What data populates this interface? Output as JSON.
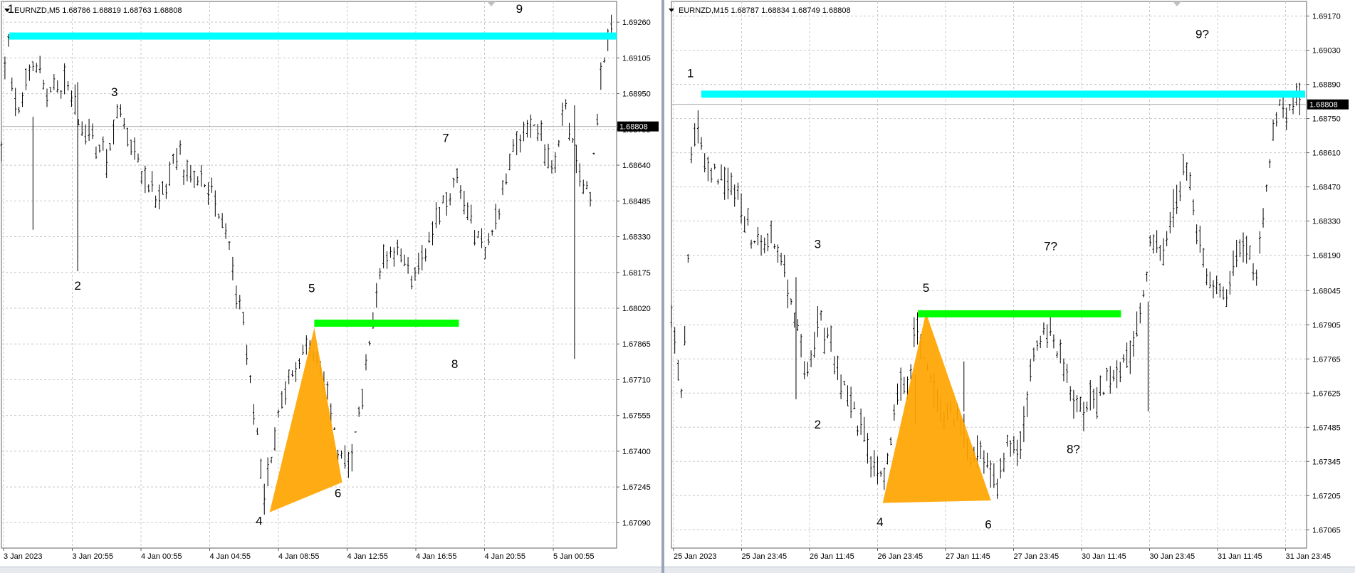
{
  "chart_data": [
    {
      "type": "candlestick",
      "symbol_header": "EURNZD,M5  1.68786 1.68819 1.68763 1.68808",
      "title": "EURNZD,M5",
      "ohlc": {
        "open": 1.68786,
        "high": 1.68819,
        "low": 1.68763,
        "close": 1.68808
      },
      "current_price": "1.68808",
      "ylim": [
        1.6698,
        1.6935
      ],
      "y_ticks": [
        "1.69260",
        "1.69105",
        "1.68950",
        "1.68795",
        "1.68640",
        "1.68485",
        "1.68330",
        "1.68175",
        "1.68020",
        "1.67865",
        "1.67710",
        "1.67555",
        "1.67400",
        "1.67245",
        "1.67090"
      ],
      "x_ticks": [
        "3 Jan 2023",
        "3 Jan 20:55",
        "4 Jan 00:55",
        "4 Jan 04:55",
        "4 Jan 08:55",
        "4 Jan 12:55",
        "4 Jan 16:55",
        "4 Jan 20:55",
        "5 Jan 00:55"
      ],
      "grid": true,
      "path_points": [
        [
          0,
          1.6875
        ],
        [
          0.01,
          1.6922
        ],
        [
          0.03,
          1.6885
        ],
        [
          0.06,
          1.691
        ],
        [
          0.09,
          1.6895
        ],
        [
          0.12,
          1.69
        ],
        [
          0.15,
          1.6885
        ],
        [
          0.18,
          1.687
        ],
        [
          0.2,
          1.6867
        ],
        [
          0.225,
          1.6888
        ],
        [
          0.25,
          1.687
        ],
        [
          0.28,
          1.6855
        ],
        [
          0.31,
          1.685
        ],
        [
          0.33,
          1.687
        ],
        [
          0.36,
          1.686
        ],
        [
          0.39,
          1.6855
        ],
        [
          0.42,
          1.684
        ],
        [
          0.44,
          1.682
        ],
        [
          0.47,
          1.678
        ],
        [
          0.5,
          1.672
        ],
        [
          0.53,
          1.676
        ],
        [
          0.58,
          1.679
        ],
        [
          0.61,
          1.6775
        ],
        [
          0.64,
          1.674
        ],
        [
          0.665,
          1.6735
        ],
        [
          0.69,
          1.677
        ],
        [
          0.72,
          1.682
        ],
        [
          0.75,
          1.683
        ],
        [
          0.78,
          1.6815
        ],
        [
          0.81,
          1.683
        ],
        [
          0.84,
          1.685
        ],
        [
          0.87,
          1.6855
        ],
        [
          0.89,
          1.684
        ],
        [
          0.92,
          1.683
        ],
        [
          0.95,
          1.6845
        ],
        [
          0.97,
          1.687
        ],
        [
          1.0,
          1.6885
        ],
        [
          1.03,
          1.6875
        ],
        [
          1.05,
          1.686
        ],
        [
          1.07,
          1.689
        ],
        [
          1.09,
          1.687
        ],
        [
          1.12,
          1.685
        ],
        [
          1.14,
          1.69
        ],
        [
          1.16,
          1.6925
        ]
      ],
      "spikes": [
        [
          0.06,
          1.6836
        ],
        [
          0.145,
          1.6818
        ],
        [
          1.09,
          1.678
        ]
      ],
      "zones": [
        {
          "color": "#00ffff",
          "price": 1.692,
          "from": 0.015,
          "to": 1.17
        },
        {
          "color": "#00ff00",
          "price": 1.67955,
          "from": 0.595,
          "to": 0.87
        }
      ],
      "triangle": {
        "color": "#ffa500",
        "points": [
          [
            0.51,
            1.67135
          ],
          [
            0.595,
            1.67935
          ],
          [
            0.648,
            1.67265
          ]
        ]
      },
      "pattern_labels": [
        {
          "text": "1",
          "x": 0.018,
          "y": 1.693
        },
        {
          "text": "2",
          "x": 0.145,
          "y": 1.681
        },
        {
          "text": "3",
          "x": 0.215,
          "y": 1.6894
        },
        {
          "text": "4",
          "x": 0.49,
          "y": 1.6708
        },
        {
          "text": "5",
          "x": 0.59,
          "y": 1.6809
        },
        {
          "text": "6",
          "x": 0.64,
          "y": 1.672
        },
        {
          "text": "7",
          "x": 0.845,
          "y": 1.6874
        },
        {
          "text": "8",
          "x": 0.862,
          "y": 1.6776
        },
        {
          "text": "9",
          "x": 0.985,
          "y": 1.693
        }
      ]
    },
    {
      "type": "candlestick",
      "symbol_header": "EURNZD,M15  1.68787 1.68834 1.68749 1.68808",
      "title": "EURNZD,M15",
      "ohlc": {
        "open": 1.68787,
        "high": 1.68834,
        "low": 1.68749,
        "close": 1.68808
      },
      "current_price": "1.68808",
      "ylim": [
        1.6699,
        1.6923
      ],
      "y_ticks": [
        "1.69170",
        "1.69030",
        "1.68890",
        "1.68750",
        "1.68610",
        "1.68470",
        "1.68330",
        "1.68190",
        "1.68045",
        "1.67905",
        "1.67765",
        "1.67625",
        "1.67485",
        "1.67345",
        "1.67205",
        "1.67065"
      ],
      "x_ticks": [
        "25 Jan 2023",
        "25 Jan 23:45",
        "26 Jan 11:45",
        "26 Jan 23:45",
        "27 Jan 11:45",
        "27 Jan 23:45",
        "30 Jan 11:45",
        "30 Jan 23:45",
        "31 Jan 11:45",
        "31 Jan 23:45"
      ],
      "grid": true,
      "path_points": [
        [
          0,
          1.6795
        ],
        [
          0.02,
          1.676
        ],
        [
          0.04,
          1.6875
        ],
        [
          0.06,
          1.686
        ],
        [
          0.09,
          1.685
        ],
        [
          0.12,
          1.6845
        ],
        [
          0.15,
          1.6825
        ],
        [
          0.18,
          1.683
        ],
        [
          0.21,
          1.681
        ],
        [
          0.235,
          1.679
        ],
        [
          0.25,
          1.6765
        ],
        [
          0.27,
          1.6795
        ],
        [
          0.29,
          1.6785
        ],
        [
          0.31,
          1.677
        ],
        [
          0.33,
          1.676
        ],
        [
          0.36,
          1.674
        ],
        [
          0.39,
          1.6725
        ],
        [
          0.42,
          1.6765
        ],
        [
          0.44,
          1.677
        ],
        [
          0.45,
          1.679
        ],
        [
          0.48,
          1.677
        ],
        [
          0.5,
          1.675
        ],
        [
          0.53,
          1.6755
        ],
        [
          0.55,
          1.6735
        ],
        [
          0.57,
          1.674
        ],
        [
          0.6,
          1.6725
        ],
        [
          0.62,
          1.6745
        ],
        [
          0.64,
          1.6735
        ],
        [
          0.67,
          1.678
        ],
        [
          0.7,
          1.679
        ],
        [
          0.72,
          1.6775
        ],
        [
          0.74,
          1.676
        ],
        [
          0.76,
          1.6755
        ],
        [
          0.78,
          1.676
        ],
        [
          0.8,
          1.6765
        ],
        [
          0.83,
          1.6775
        ],
        [
          0.85,
          1.678
        ],
        [
          0.87,
          1.68
        ],
        [
          0.89,
          1.683
        ],
        [
          0.91,
          1.682
        ],
        [
          0.93,
          1.684
        ],
        [
          0.95,
          1.686
        ],
        [
          0.97,
          1.683
        ],
        [
          0.99,
          1.681
        ],
        [
          1.02,
          1.68
        ],
        [
          1.05,
          1.6825
        ],
        [
          1.08,
          1.681
        ],
        [
          1.1,
          1.685
        ],
        [
          1.12,
          1.688
        ]
      ],
      "spikes": [
        [
          0.23,
          1.676
        ],
        [
          0.45,
          1.675
        ],
        [
          0.54,
          1.67755
        ],
        [
          0.88,
          1.6755
        ]
      ],
      "zones": [
        {
          "color": "#00ffff",
          "price": 1.6885,
          "from": 0.055,
          "to": 1.17
        },
        {
          "color": "#00ff00",
          "price": 1.6795,
          "from": 0.455,
          "to": 0.83
        }
      ],
      "triangle": {
        "color": "#ffa500",
        "points": [
          [
            0.39,
            1.67175
          ],
          [
            0.47,
            1.67955
          ],
          [
            0.59,
            1.67185
          ]
        ]
      },
      "pattern_labels": [
        {
          "text": "1",
          "x": 0.035,
          "y": 1.6892
        },
        {
          "text": "2",
          "x": 0.27,
          "y": 1.6748
        },
        {
          "text": "3",
          "x": 0.27,
          "y": 1.6822
        },
        {
          "text": "4",
          "x": 0.385,
          "y": 1.6708
        },
        {
          "text": "5",
          "x": 0.47,
          "y": 1.6804
        },
        {
          "text": "6",
          "x": 0.585,
          "y": 1.6707
        },
        {
          "text": "7?",
          "x": 0.7,
          "y": 1.6821
        },
        {
          "text": "8?",
          "x": 0.742,
          "y": 1.6738
        },
        {
          "text": "9?",
          "x": 0.98,
          "y": 1.6908
        }
      ]
    }
  ]
}
